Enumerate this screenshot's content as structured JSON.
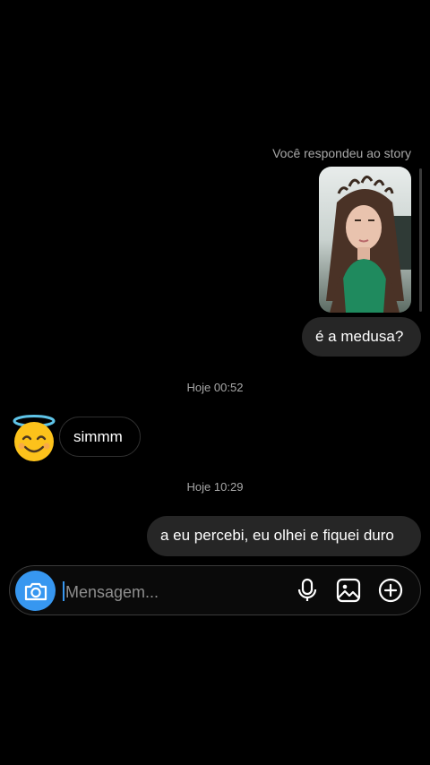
{
  "thread": {
    "story_reply_caption": "Você respondeu ao story",
    "story_reply_text": "é a medusa?",
    "timestamps": [
      "Hoje 00:52",
      "Hoje 10:29"
    ],
    "incoming_message": "simmm",
    "outgoing_message": "a eu percebi, eu olhei e fiquei duro",
    "avatar": "smiling-face-with-halo-emoji"
  },
  "composer": {
    "placeholder": "Mensagem...",
    "icons": [
      "camera-icon",
      "microphone-icon",
      "image-icon",
      "plus-icon"
    ]
  },
  "colors": {
    "background": "#000000",
    "outgoing_bubble": "#262626",
    "accent": "#3797f0",
    "secondary_text": "#a8a8a8"
  }
}
